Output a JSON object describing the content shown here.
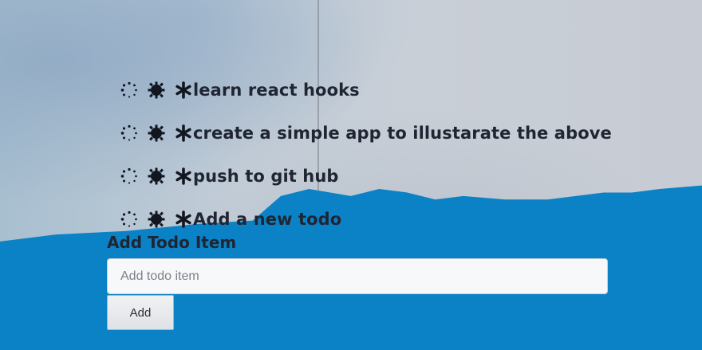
{
  "todos": [
    {
      "text": "learn react hooks"
    },
    {
      "text": "create a simple app to illustarate the above"
    },
    {
      "text": "push to git hub"
    },
    {
      "text": "Add a new todo"
    }
  ],
  "todo_icons": [
    "spinner-icon",
    "gear-icon",
    "asterisk-icon"
  ],
  "form": {
    "title": "Add Todo Item",
    "input_placeholder": "Add todo item",
    "add_label": "Add"
  },
  "colors": {
    "blue_paper": "#0b82c5",
    "text": "#1f2532"
  }
}
